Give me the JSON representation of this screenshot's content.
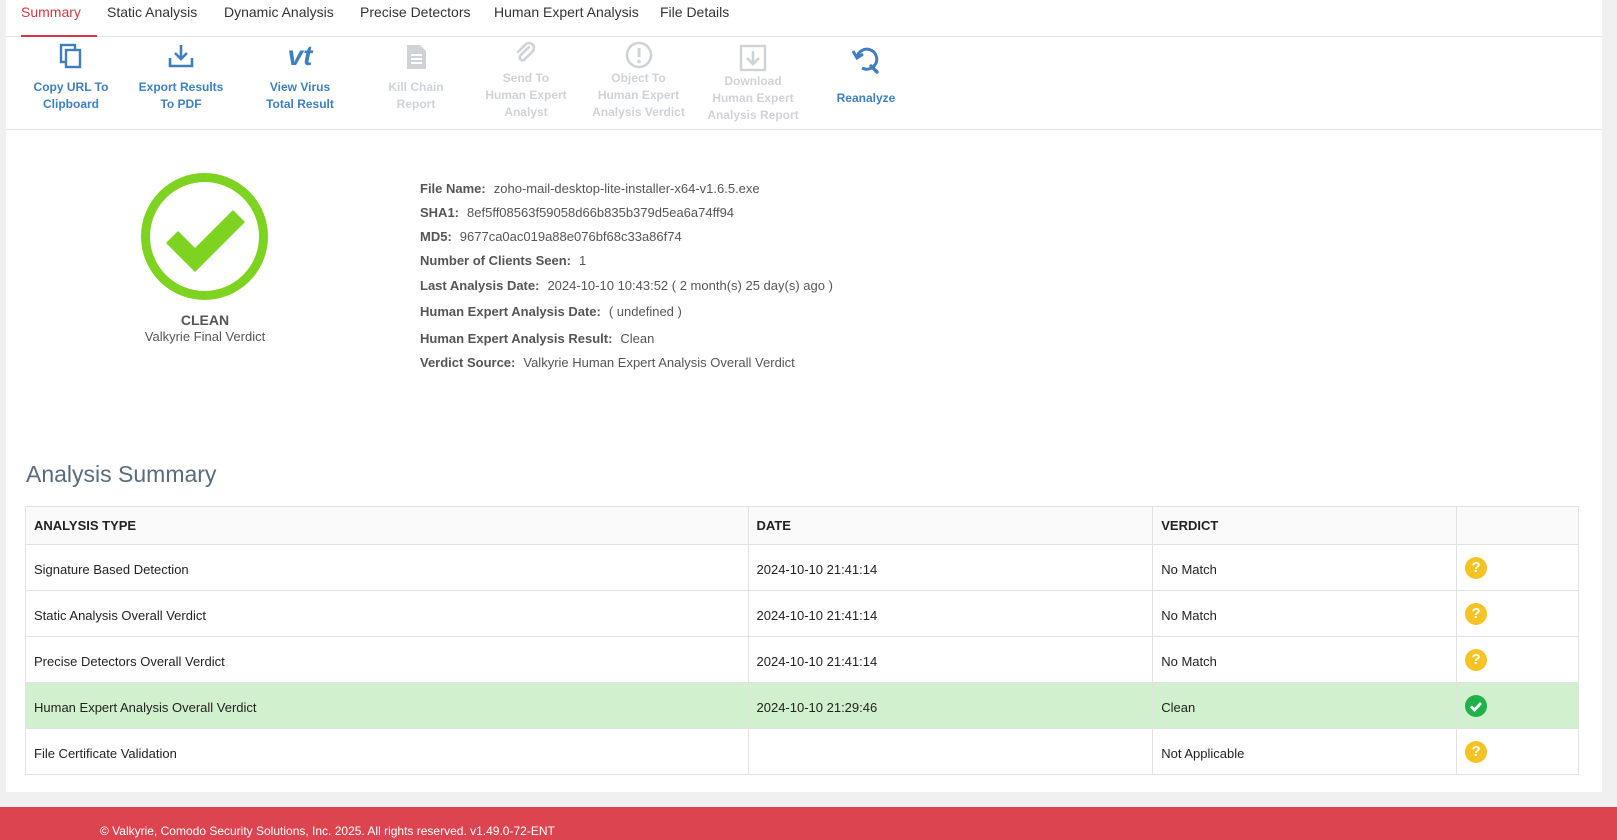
{
  "tabs": [
    {
      "label": "Summary",
      "active": true
    },
    {
      "label": "Static Analysis"
    },
    {
      "label": "Dynamic Analysis"
    },
    {
      "label": "Precise Detectors"
    },
    {
      "label": "Human Expert Analysis"
    },
    {
      "label": "File Details"
    }
  ],
  "toolbar": [
    {
      "label": "Copy URL To\nClipboard",
      "icon": "copy-icon",
      "enabled": true
    },
    {
      "label": "Export Results\nTo PDF",
      "icon": "download-icon",
      "enabled": true
    },
    {
      "label": "View Virus\nTotal Result",
      "icon": "vt-icon",
      "enabled": true
    },
    {
      "label": "Kill Chain\nReport",
      "icon": "document-icon",
      "enabled": false
    },
    {
      "label": "Send To\nHuman Expert\nAnalyst",
      "icon": "paperclip-icon",
      "enabled": false
    },
    {
      "label": "Object To\nHuman Expert\nAnalysis Verdict",
      "icon": "exclamation-icon",
      "enabled": false
    },
    {
      "label": "Download\nHuman Expert\nAnalysis Report",
      "icon": "download-box-icon",
      "enabled": false
    },
    {
      "label": "Reanalyze",
      "icon": "refresh-icon",
      "enabled": true
    }
  ],
  "verdict": {
    "word": "CLEAN",
    "subtitle": "Valkyrie Final Verdict",
    "color": "#7ed321"
  },
  "file_info": [
    {
      "label": "File Name:",
      "value": "zoho-mail-desktop-lite-installer-x64-v1.6.5.exe"
    },
    {
      "label": "SHA1:",
      "value": "8ef5ff08563f59058d66b835b379d5ea6a74ff94"
    },
    {
      "label": "MD5:",
      "value": "9677ca0ac019a88e076bf68c33a86f74"
    },
    {
      "label": "Number of Clients Seen:",
      "value": "1"
    },
    {
      "label": "Last Analysis Date:",
      "value": "2024-10-10 10:43:52 ( 2 month(s) 25 day(s) ago )"
    },
    {
      "label": "Human Expert Analysis Date:",
      "value": "( undefined )"
    },
    {
      "label": "Human Expert Analysis Result:",
      "value": "Clean"
    },
    {
      "label": "Verdict Source:",
      "value": "Valkyrie Human Expert Analysis Overall Verdict"
    }
  ],
  "analysis_summary": {
    "title": "Analysis Summary",
    "columns": [
      "ANALYSIS TYPE",
      "DATE",
      "VERDICT"
    ],
    "rows": [
      {
        "type": "Signature Based Detection",
        "date": "2024-10-10 21:41:14",
        "verdict": "No Match",
        "icon": "question-icon"
      },
      {
        "type": "Static Analysis Overall Verdict",
        "date": "2024-10-10 21:41:14",
        "verdict": "No Match",
        "icon": "question-icon"
      },
      {
        "type": "Precise Detectors Overall Verdict",
        "date": "2024-10-10 21:41:14",
        "verdict": "No Match",
        "icon": "question-icon"
      },
      {
        "type": "Human Expert Analysis Overall Verdict",
        "date": "2024-10-10 21:29:46",
        "verdict": "Clean",
        "icon": "check-circle-icon",
        "highlight": true
      },
      {
        "type": "File Certificate Validation",
        "date": "",
        "verdict": "Not Applicable",
        "icon": "question-icon"
      }
    ]
  },
  "footer": {
    "text": "© Valkyrie, Comodo Security Solutions, Inc. 2025. All rights reserved. v1.49.0-72-ENT"
  },
  "colors": {
    "accent": "#d0393f",
    "link": "#3d7fc1",
    "footer": "#dc4450",
    "highlight_row": "#d1f0cd"
  }
}
